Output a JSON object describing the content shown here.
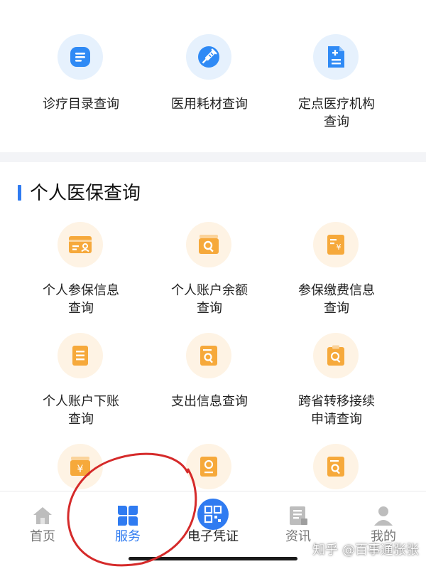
{
  "colors": {
    "accent_blue": "#2f7bf1",
    "icon_blue": "#2f8af5",
    "icon_orange": "#f6a93b",
    "annotation_red": "#d52a2a"
  },
  "top_services": [
    {
      "label": "诊疗目录查询",
      "icon": "document-lines-icon"
    },
    {
      "label": "医用耗材查询",
      "icon": "syringe-icon"
    },
    {
      "label": "定点医疗机构\n查询",
      "icon": "medical-file-icon"
    }
  ],
  "personal_section": {
    "title": "个人医保查询",
    "items": [
      {
        "label": "个人参保信息\n查询",
        "icon": "id-card-icon"
      },
      {
        "label": "个人账户余额\n查询",
        "icon": "wallet-search-icon"
      },
      {
        "label": "参保缴费信息\n查询",
        "icon": "yuan-bill-icon"
      },
      {
        "label": "个人账户下账\n查询",
        "icon": "list-document-icon"
      },
      {
        "label": "支出信息查询",
        "icon": "doc-search-icon"
      },
      {
        "label": "跨省转移接续\n申请查询",
        "icon": "clipboard-search-icon"
      },
      {
        "label": "",
        "icon": "yuan-card-icon"
      },
      {
        "label": "",
        "icon": "location-pin-icon"
      },
      {
        "label": "",
        "icon": "doc-search-icon"
      }
    ]
  },
  "tabbar": {
    "tabs": [
      {
        "label": "首页",
        "icon": "home-icon"
      },
      {
        "label": "服务",
        "icon": "grid-clover-icon"
      },
      {
        "label": "电子凭证",
        "icon": "qr-code-icon"
      },
      {
        "label": "资讯",
        "icon": "news-icon"
      },
      {
        "label": "我的",
        "icon": "user-icon"
      }
    ],
    "active_index": 1
  },
  "watermark": "知乎 @百事通张张"
}
